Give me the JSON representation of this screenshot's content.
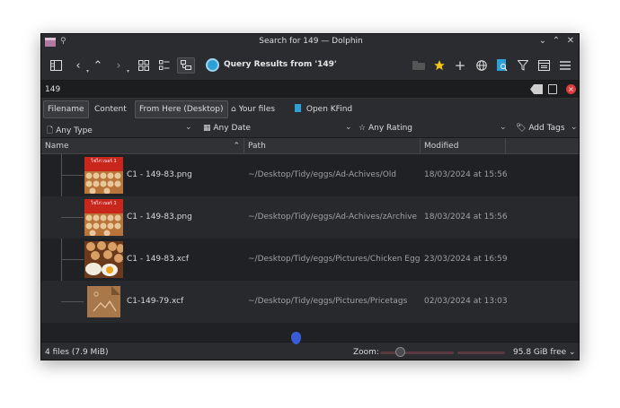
{
  "window": {
    "title": "Search for 149 — Dolphin"
  },
  "toolbar": {
    "query_label": "Query Results from '149'"
  },
  "search": {
    "value": "149"
  },
  "filters": {
    "filename": "Filename",
    "content": "Content",
    "from_here": "From Here (Desktop)",
    "your_files": "Your files",
    "open_kfind": "Open KFind"
  },
  "facets": {
    "type": "Any Type",
    "date": "Any Date",
    "rating": "Any Rating",
    "tags": "Add Tags"
  },
  "columns": {
    "name": "Name",
    "path": "Path",
    "modified": "Modified"
  },
  "files": [
    {
      "name": "C1 - 149-83.png",
      "path": "~/Desktop/Tidy/eggs/Ad-Achives/Old",
      "modified": "18/03/2024 at 15:56",
      "thumb_text": "ไข่ไก่ เบอร์ 1",
      "thumb": "egg-poster"
    },
    {
      "name": "C1 - 149-83.png",
      "path": "~/Desktop/Tidy/eggs/Ad-Achives/zArchive",
      "modified": "18/03/2024 at 15:56",
      "thumb_text": "ไข่ไก่ เบอร์ 1",
      "thumb": "egg-poster"
    },
    {
      "name": "C1 - 149-83.xcf",
      "path": "~/Desktop/Tidy/eggs/Pictures/Chicken Eggs",
      "modified": "23/03/2024 at 16:59",
      "thumb_text": "",
      "thumb": "egg-photo"
    },
    {
      "name": "C1-149-79.xcf",
      "path": "~/Desktop/Tidy/eggs/Pictures/Pricetags",
      "modified": "02/03/2024 at 13:03",
      "thumb_text": "",
      "thumb": "image-placeholder"
    }
  ],
  "status": {
    "summary": "4 files (7.9 MiB)",
    "zoom_label": "Zoom:",
    "zoom_level": 0.27,
    "free_space": "95.8 GiB free"
  },
  "colors": {
    "accent": "#2ea0d8",
    "close": "#e03a3a",
    "favorite": "#f5c518"
  }
}
